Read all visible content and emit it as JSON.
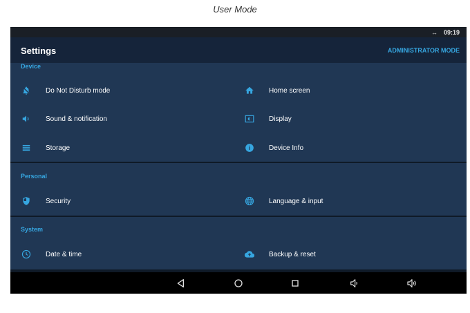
{
  "caption": "User Mode",
  "status": {
    "clock": "09:19",
    "connection_icon": "arrows-left-right-icon"
  },
  "appbar": {
    "title": "Settings",
    "admin_label": "ADMINISTRATOR MODE"
  },
  "sections": {
    "device": {
      "header": "Device",
      "items": [
        {
          "label": "Do Not Disturb mode",
          "icon": "bell-off-icon"
        },
        {
          "label": "Home screen",
          "icon": "home-icon"
        },
        {
          "label": "Sound & notification",
          "icon": "volume-icon"
        },
        {
          "label": "Display",
          "icon": "display-icon"
        },
        {
          "label": "Storage",
          "icon": "storage-icon"
        },
        {
          "label": "Device Info",
          "icon": "info-icon"
        }
      ]
    },
    "personal": {
      "header": "Personal",
      "items": [
        {
          "label": "Security",
          "icon": "shield-icon"
        },
        {
          "label": "Language & input",
          "icon": "globe-icon"
        }
      ]
    },
    "system": {
      "header": "System",
      "items": [
        {
          "label": "Date & time",
          "icon": "clock-icon"
        },
        {
          "label": "Backup & reset",
          "icon": "cloud-upload-icon"
        }
      ]
    }
  },
  "navbar": [
    "back-icon",
    "home-circle-icon",
    "recents-icon",
    "volume-down-icon",
    "volume-up-icon"
  ],
  "colors": {
    "accent": "#36a6e0",
    "panel": "#203754",
    "appbar": "#15243a",
    "background": "#0f1a27"
  }
}
